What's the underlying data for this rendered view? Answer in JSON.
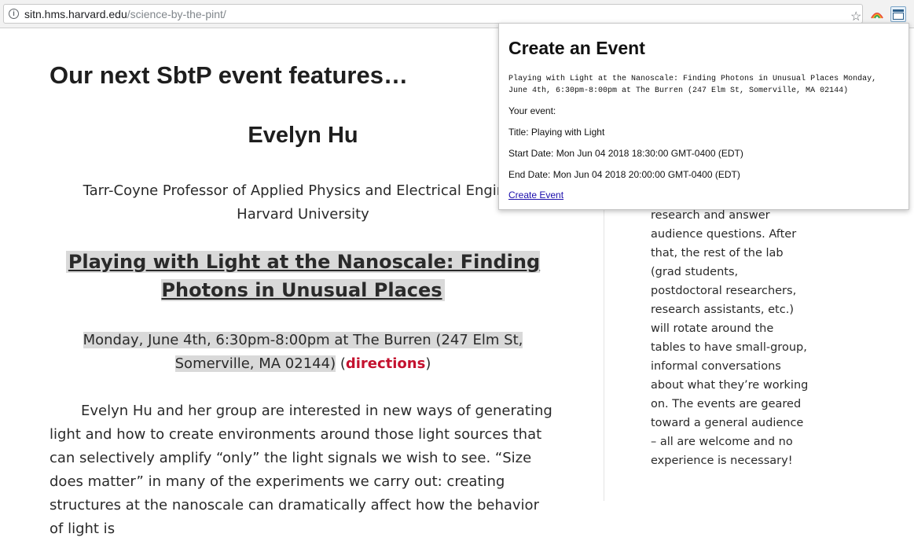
{
  "browser": {
    "url_host": "sitn.hms.harvard.edu",
    "url_path": "/science-by-the-pint/",
    "icons": [
      "info-icon",
      "bookmark-star-icon",
      "rainbow-extension-icon",
      "calendar-extension-icon"
    ]
  },
  "page": {
    "heading": "Our next SbtP event features…",
    "speaker": "Evelyn Hu",
    "affiliation_line1": "Tarr-Coyne Professor of Applied Physics and Electrical Enginee",
    "affiliation_line2": "Harvard University",
    "talk_title": "Playing with Light at the Nanoscale: Finding Photons in Unusual Places",
    "event_details": "Monday, June 4th, 6:30pm-8:00pm at The Burren (247 Elm St, Somerville, MA 02144)",
    "paren_open": " (",
    "directions_label": "directions",
    "paren_close": ")",
    "body": "Evelyn Hu and her group are interested in new ways of generating light and how to create environments around those light sources that can selectively amplify “only” the light signals we wish to see. “Size does matter” in many of the experiments we carry out: creating structures at the nanoscale can dramatically affect how the behavior of light is"
  },
  "sidebar": {
    "text": "research and answer audience questions. After that, the rest of the lab (grad students, postdoctoral researchers, research assistants, etc.) will rotate around the tables to have small-group, informal conversations about what they’re working on. The events are geared toward a general audience – all are welcome and no experience is necessary!"
  },
  "popup": {
    "title": "Create an Event",
    "raw_text": "Playing with Light at the Nanoscale: Finding Photons in Unusual Places Monday, June 4th, 6:30pm-8:00pm at The Burren (247 Elm St, Somerville, MA 02144)",
    "your_event_label": "Your event:",
    "title_line": "Title: Playing with Light",
    "start_line": "Start Date: Mon Jun 04 2018 18:30:00 GMT-0400 (EDT)",
    "end_line": "End Date: Mon Jun 04 2018 20:00:00 GMT-0400 (EDT)",
    "create_link": "Create Event"
  },
  "colors": {
    "link_red": "#c4122f",
    "highlight": "#d9d9d9",
    "popup_link": "#1a0dab"
  }
}
